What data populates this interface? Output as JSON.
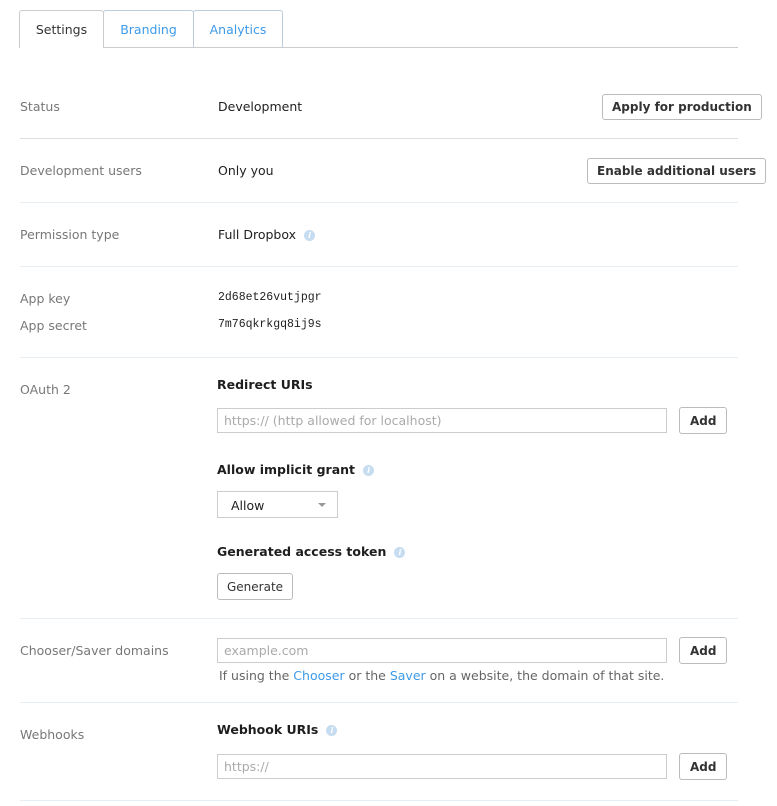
{
  "tabs": [
    {
      "label": "Settings",
      "active": true
    },
    {
      "label": "Branding"
    },
    {
      "label": "Analytics"
    }
  ],
  "status": {
    "label": "Status",
    "value": "Development",
    "button": "Apply for production"
  },
  "dev_users": {
    "label": "Development users",
    "value": "Only you",
    "button": "Enable additional users"
  },
  "permission": {
    "label": "Permission type",
    "value": "Full Dropbox",
    "icon": "info-icon"
  },
  "app_key": {
    "label": "App key",
    "value": "2d68et26vutjpgr"
  },
  "app_secret": {
    "label": "App secret",
    "value": "7m76qkrkgq8ij9s"
  },
  "oauth": {
    "label": "OAuth 2",
    "redirect_heading": "Redirect URIs",
    "redirect_placeholder": "https:// (http allowed for localhost)",
    "add": "Add",
    "implicit_heading": "Allow implicit grant",
    "implicit_value": "Allow",
    "token_heading": "Generated access token",
    "generate": "Generate"
  },
  "chooser": {
    "label": "Chooser/Saver domains",
    "placeholder": "example.com",
    "add": "Add",
    "help_pre": "If using the ",
    "chooser_link": "Chooser",
    "help_mid": " or the ",
    "saver_link": "Saver",
    "help_post": " on a website, the domain of that site."
  },
  "webhooks": {
    "label": "Webhooks",
    "heading": "Webhook URIs",
    "placeholder": "https://",
    "add": "Add"
  },
  "colors": {
    "link": "#3d9ae8",
    "info_icon": "#c6dcf0"
  }
}
